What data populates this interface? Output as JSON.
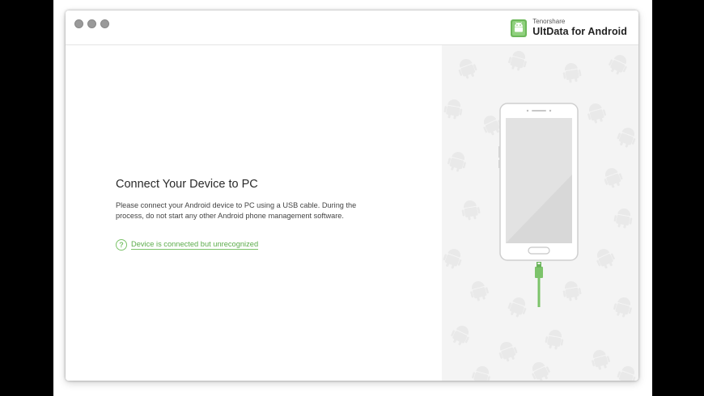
{
  "window": {
    "brand_company": "Tenorshare",
    "brand_product": "UltData for Android"
  },
  "main": {
    "heading": "Connect Your Device to PC",
    "description": "Please connect your Android device to PC using a USB cable. During the process, do not start any other Android phone management software.",
    "help_link": "Device is connected but unrecognized",
    "help_icon_glyph": "?"
  },
  "colors": {
    "accent": "#7cc36a",
    "link": "#5bab4a",
    "panel": "#f4f4f4"
  },
  "icons": {
    "brand": "android-robot-logo",
    "help": "question-circle-icon",
    "illustration": "android-phone-usb-illustration"
  }
}
